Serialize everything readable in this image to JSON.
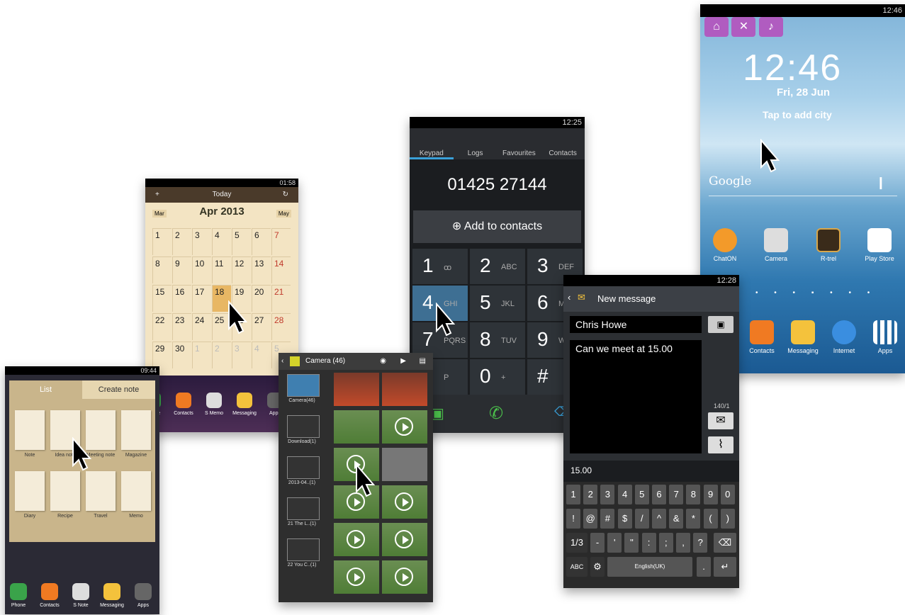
{
  "home": {
    "status_time": "12:46",
    "clock": "12:46",
    "date": "Fri, 28 Jun",
    "city_hint": "Tap to add city",
    "search": "Google",
    "apps_row1": [
      "ChatON",
      "Camera",
      "R-trel",
      "Play Store"
    ],
    "apps_row2": [
      "Contacts",
      "Messaging",
      "Internet",
      "Apps"
    ]
  },
  "dialer": {
    "status_time": "12:25",
    "tabs": [
      "Keypad",
      "Logs",
      "Favourites",
      "Contacts"
    ],
    "number": "01425 27144",
    "add_label": "Add to contacts",
    "keys": [
      {
        "n": "1",
        "l": "ꝏ"
      },
      {
        "n": "2",
        "l": "ABC"
      },
      {
        "n": "3",
        "l": "DEF"
      },
      {
        "n": "4",
        "l": "GHI"
      },
      {
        "n": "5",
        "l": "JKL"
      },
      {
        "n": "6",
        "l": "MNO"
      },
      {
        "n": "7",
        "l": "PQRS"
      },
      {
        "n": "8",
        "l": "TUV"
      },
      {
        "n": "9",
        "l": "WXYZ"
      },
      {
        "n": "*",
        "l": "P"
      },
      {
        "n": "0",
        "l": "+"
      },
      {
        "n": "#",
        "l": ""
      }
    ]
  },
  "message": {
    "status_time": "12:28",
    "title": "New message",
    "to": "Chris Howe",
    "body": "Can we meet at 15.00",
    "counter": "140/1",
    "preview": "15.00",
    "row1": [
      "1",
      "2",
      "3",
      "4",
      "5",
      "6",
      "7",
      "8",
      "9",
      "0"
    ],
    "row2": [
      "!",
      "@",
      "#",
      "$",
      "/",
      "^",
      "&",
      "*",
      "(",
      ")"
    ],
    "row3": [
      "1/3",
      "-",
      "'",
      "\"",
      ":",
      ";",
      ",",
      "?"
    ],
    "space_label": "English(UK)",
    "abc": "ABC"
  },
  "calendar": {
    "status_time": "01:58",
    "today": "Today",
    "month": "Apr 2013",
    "prev": "Mar",
    "next": "May",
    "days": [
      [
        "1",
        "2",
        "3",
        "4",
        "5",
        "6",
        "7"
      ],
      [
        "8",
        "9",
        "10",
        "11",
        "12",
        "13",
        "14"
      ],
      [
        "15",
        "16",
        "17",
        "18",
        "19",
        "20",
        "21"
      ],
      [
        "22",
        "23",
        "24",
        "25",
        "26",
        "27",
        "28"
      ],
      [
        "29",
        "30",
        "1",
        "2",
        "3",
        "4",
        "5"
      ]
    ],
    "dock": [
      "Phone",
      "Contacts",
      "S Memo",
      "Messaging",
      "Apps"
    ]
  },
  "notes": {
    "status_time": "09:44",
    "tab_list": "List",
    "tab_create": "Create note",
    "templates": [
      "Note",
      "Idea note",
      "Meeting note",
      "Magazine",
      "Diary",
      "Recipe",
      "Travel",
      "Memo"
    ],
    "dock": [
      "Phone",
      "Contacts",
      "S Note",
      "Messaging",
      "Apps"
    ]
  },
  "gallery": {
    "title": "Camera (46)",
    "albums": [
      "Camera(46)",
      "Download(1)",
      "2013-04..(1)",
      "21 The L..(1)",
      "22 You C..(1)"
    ]
  }
}
